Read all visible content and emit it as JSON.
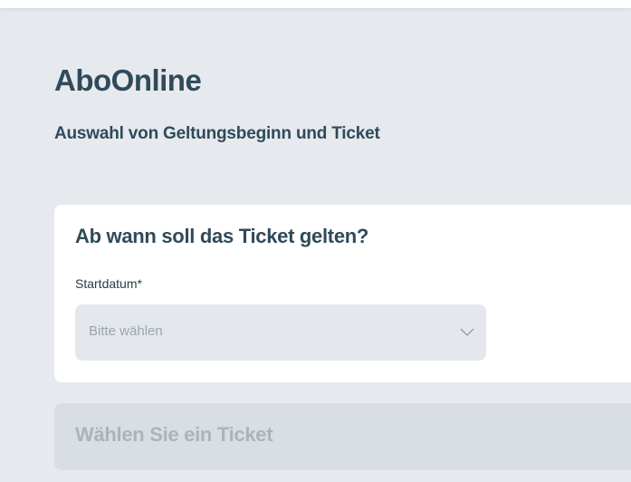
{
  "header": {
    "title": "AboOnline",
    "subtitle": "Auswahl von Geltungsbeginn und Ticket"
  },
  "start_card": {
    "title": "Ab wann soll das Ticket gelten?",
    "field_label": "Startdatum*",
    "select": {
      "placeholder": "Bitte wählen",
      "icon": "chevron-down-icon"
    }
  },
  "ticket_section": {
    "title": "Wählen Sie ein Ticket"
  },
  "colors": {
    "background": "#e6eaee",
    "heading": "#2f4a5a",
    "card": "#ffffff",
    "select_bg": "#e4e8ec",
    "placeholder": "#9aa6ae",
    "disabled_section": "#d9dee3",
    "disabled_text": "#aab4bb"
  }
}
